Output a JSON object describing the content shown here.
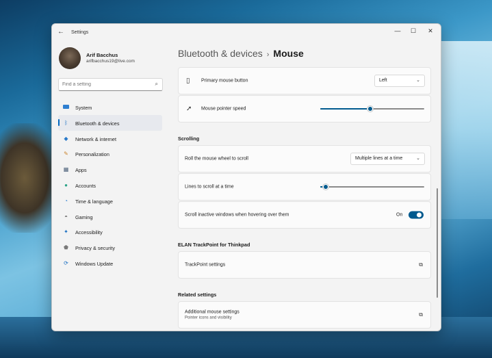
{
  "colors": {
    "accent": "#0067c0",
    "slider": "#005a8e",
    "toggle_on": "#005a8e"
  },
  "window": {
    "title": "Settings",
    "back_icon": "arrow-left-icon"
  },
  "user": {
    "name": "Arif Bacchus",
    "email": "arifbacchus19@live.com"
  },
  "search": {
    "placeholder": "Find a setting",
    "icon": "search-icon"
  },
  "nav": [
    {
      "label": "System",
      "icon": "monitor-icon"
    },
    {
      "label": "Bluetooth & devices",
      "icon": "bluetooth-icon",
      "active": true
    },
    {
      "label": "Network & internet",
      "icon": "wifi-icon"
    },
    {
      "label": "Personalization",
      "icon": "brush-icon"
    },
    {
      "label": "Apps",
      "icon": "apps-icon"
    },
    {
      "label": "Accounts",
      "icon": "person-icon"
    },
    {
      "label": "Time & language",
      "icon": "globe-clock-icon"
    },
    {
      "label": "Gaming",
      "icon": "gamepad-icon"
    },
    {
      "label": "Accessibility",
      "icon": "accessibility-icon"
    },
    {
      "label": "Privacy & security",
      "icon": "shield-icon"
    },
    {
      "label": "Windows Update",
      "icon": "update-icon"
    }
  ],
  "breadcrumb": {
    "parent": "Bluetooth & devices",
    "separator": "›",
    "current": "Mouse"
  },
  "settings": {
    "primary_button": {
      "label": "Primary mouse button",
      "value": "Left",
      "icon": "mouse-icon"
    },
    "pointer_speed": {
      "label": "Mouse pointer speed",
      "value_fraction": 0.48,
      "icon": "pointer-icon"
    },
    "scrolling_title": "Scrolling",
    "roll_wheel": {
      "label": "Roll the mouse wheel to scroll",
      "value": "Multiple lines at a time"
    },
    "lines_to_scroll": {
      "label": "Lines to scroll at a time",
      "value_fraction": 0.05
    },
    "inactive_scroll": {
      "label": "Scroll inactive windows when hovering over them",
      "state": "On"
    },
    "elan_title": "ELAN TrackPoint for Thinkpad",
    "trackpoint": {
      "label": "TrackPoint settings",
      "icon": "open-external-icon"
    },
    "related_title": "Related settings",
    "additional_mouse": {
      "label": "Additional mouse settings",
      "sub": "Pointer icons and visibility",
      "icon": "open-external-icon"
    }
  }
}
